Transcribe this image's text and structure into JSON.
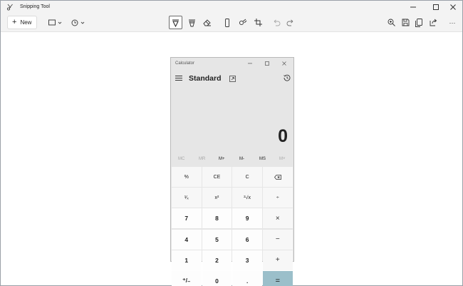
{
  "window": {
    "title": "Snipping Tool",
    "controls": {
      "minimize": "–",
      "maximize": "☐",
      "close": "✕"
    }
  },
  "toolbar": {
    "new_label": "New",
    "new_icon": "plus-icon",
    "left_tools": [
      "snip-mode-icon",
      "delay-timer-icon"
    ],
    "center_tools": [
      "ballpoint-pen-icon",
      "highlighter-icon",
      "eraser-icon",
      "ruler-icon",
      "touch-writing-icon",
      "crop-icon",
      "undo-icon",
      "redo-icon"
    ],
    "right_tools": [
      "zoom-icon",
      "save-icon",
      "copy-icon",
      "share-icon",
      "more-icon"
    ],
    "more_label": "···"
  },
  "calculator": {
    "title": "Calculator",
    "mode": "Standard",
    "display": "0",
    "memory": [
      {
        "label": "MC",
        "disabled": true
      },
      {
        "label": "MR",
        "disabled": true
      },
      {
        "label": "M+",
        "disabled": false
      },
      {
        "label": "M-",
        "disabled": false
      },
      {
        "label": "MS",
        "disabled": false
      },
      {
        "label": "M˅",
        "disabled": true
      }
    ],
    "keys": [
      "%",
      "CE",
      "C",
      "⌫",
      "¹⁄ₓ",
      "x²",
      "²√x",
      "÷",
      "7",
      "8",
      "9",
      "×",
      "4",
      "5",
      "6",
      "−",
      "1",
      "2",
      "3",
      "+",
      "⁺/₋",
      "0",
      ".",
      "="
    ],
    "accent_color": "#9bbfca"
  }
}
